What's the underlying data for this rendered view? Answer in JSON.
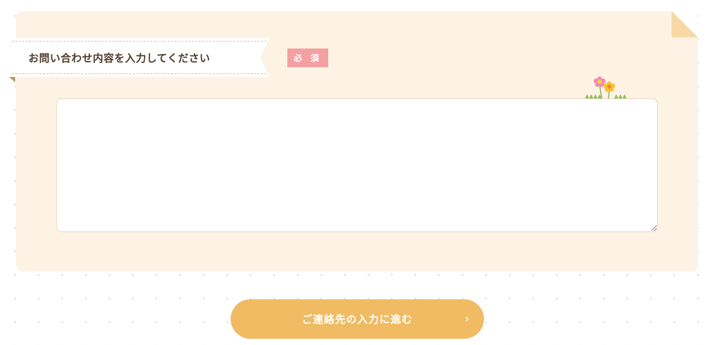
{
  "form": {
    "field_label": "お問い合わせ内容を入力してください",
    "required_badge": "必 須",
    "message_value": "",
    "message_placeholder": ""
  },
  "actions": {
    "submit_label": "ご連絡先の入力に進む",
    "submit_icon": "chevron-right-icon",
    "submit_icon_glyph": "›"
  },
  "colors": {
    "card_background": "#fdf3e4",
    "required_badge": "#f4a0a3",
    "submit_button": "#f0bb62",
    "label_text": "#4f3c2a"
  }
}
